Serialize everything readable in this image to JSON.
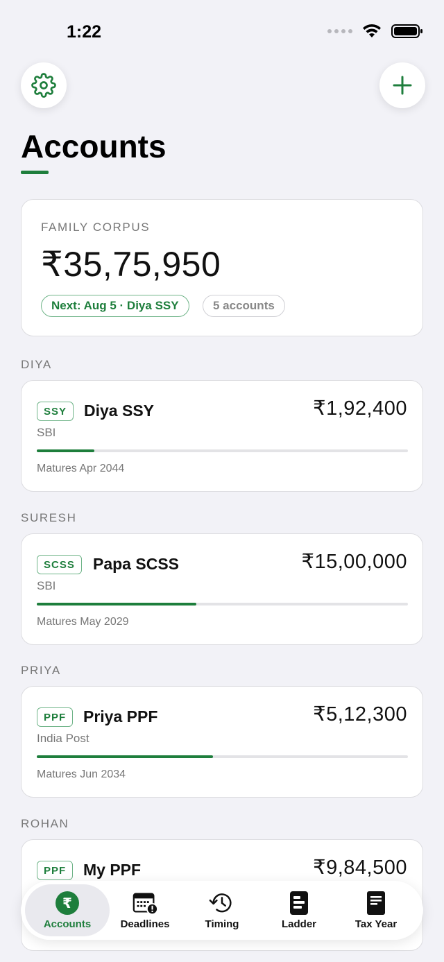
{
  "status_bar": {
    "time": "1:22",
    "icons": [
      "cellular-dots-icon",
      "wifi-icon",
      "battery-icon"
    ]
  },
  "header": {
    "settings_icon": "gear-icon",
    "add_icon": "plus-icon",
    "title": "Accounts",
    "accent_color": "#1e7e3c"
  },
  "corpus": {
    "label": "FAMILY CORPUS",
    "value": "₹35,75,950",
    "next_chip": "Next: Aug 5 · Diya SSY",
    "count_chip": "5 accounts"
  },
  "sections": [
    {
      "owner": "DIYA",
      "accounts": [
        {
          "badge": "SSY",
          "name": "Diya SSY",
          "amount": "₹1,92,400",
          "bank": "SBI",
          "progress": 0.155,
          "maturity": "Matures Apr 2044"
        }
      ]
    },
    {
      "owner": "SURESH",
      "accounts": [
        {
          "badge": "SCSS",
          "name": "Papa SCSS",
          "amount": "₹15,00,000",
          "bank": "SBI",
          "progress": 0.43,
          "maturity": "Matures May 2029"
        }
      ]
    },
    {
      "owner": "PRIYA",
      "accounts": [
        {
          "badge": "PPF",
          "name": "Priya PPF",
          "amount": "₹5,12,300",
          "bank": "India Post",
          "progress": 0.475,
          "maturity": "Matures Jun 2034"
        }
      ]
    },
    {
      "owner": "ROHAN",
      "accounts": [
        {
          "badge": "PPF",
          "name": "My PPF",
          "amount": "₹9,84,500",
          "bank": "",
          "progress": 0,
          "maturity": ""
        }
      ]
    }
  ],
  "tabs": [
    {
      "label": "Accounts",
      "icon": "rupee-icon",
      "active": true
    },
    {
      "label": "Deadlines",
      "icon": "calendar-alert-icon",
      "active": false
    },
    {
      "label": "Timing",
      "icon": "clock-history-icon",
      "active": false
    },
    {
      "label": "Ladder",
      "icon": "ladder-doc-icon",
      "active": false
    },
    {
      "label": "Tax Year",
      "icon": "document-icon",
      "active": false
    }
  ]
}
